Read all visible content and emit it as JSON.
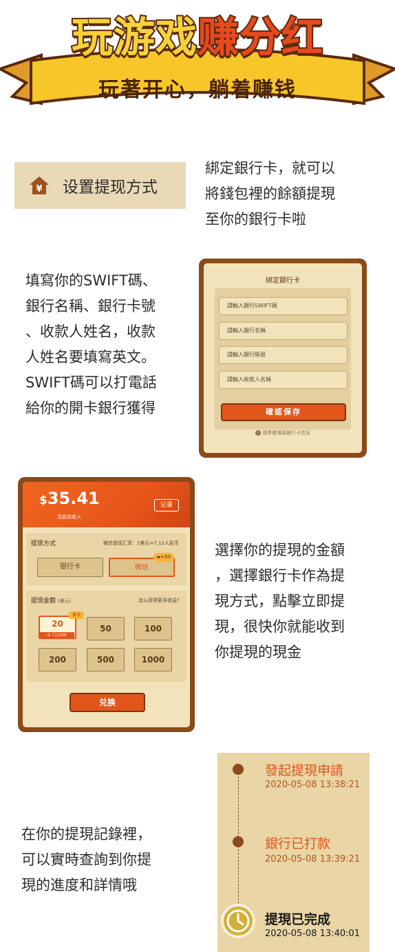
{
  "header": {
    "title_part1": "玩游戏",
    "title_part2": "赚分红",
    "subtitle": "玩著开心，躺着赚钱"
  },
  "section1": {
    "setup_button_label": "设置提现方式",
    "yen_icon": "yen-house-icon",
    "description": [
      "綁定銀行卡，就可以",
      "將錢包裡的餘額提現",
      "至你的銀行卡啦"
    ]
  },
  "section2": {
    "description": [
      "填寫你的SWIFT碼、",
      "銀行名稱、銀行卡號",
      "、收款人姓名，收款",
      "人姓名要填寫英文。",
      "SWIFT碼可以打電話",
      "給你的開卡銀行獲得"
    ],
    "bind_card": {
      "title": "綁定銀行卡",
      "fields": [
        "請輸入銀行SWIFT碼",
        "請輸入銀行名稱",
        "請輸入銀行賬號",
        "請輸入收款人名稱"
      ],
      "save_label": "確認保存",
      "hint": "請準確填寫銀行卡信息"
    }
  },
  "section3": {
    "description": [
      "選擇你的提現的金額",
      "，選擇銀行卡作為提",
      "現方式，點擊立即提",
      "現，很快你就能收到",
      "你提現的現金"
    ],
    "withdraw": {
      "currency": "$",
      "amount": "35.41",
      "amount_label": "当前总收入",
      "record_label": "记录",
      "method_label": "提现方式",
      "rate_text": "微信提现汇率：1美元=7.12人民币",
      "methods": [
        "银行卡",
        "微信"
      ],
      "method_selected": "微信",
      "wechat_bonus": "+50",
      "amount_section_label": "提现金额",
      "amount_unit": "(美元)",
      "help_link": "怎么获得更多收益?",
      "options": [
        "20",
        "50",
        "100",
        "200",
        "500",
        "1000"
      ],
      "first_badge": "首次",
      "first_progress": "11/100",
      "exchange_label": "兑换"
    }
  },
  "section4": {
    "description": [
      "在你的提現記錄裡，",
      "可以實時查詢到你提",
      "現的進度和詳情哦"
    ],
    "timeline": [
      {
        "title": "發起提現申請",
        "time": "2020-05-08 13:38:21"
      },
      {
        "title": "銀行已打款",
        "time": "2020-05-08 13:39:21"
      },
      {
        "title": "提現已完成",
        "time": "2020-05-08 13:40:01"
      }
    ],
    "colors": {
      "accent": "#e2561b",
      "brown": "#8b4a1b",
      "panel": "#e9d5a5"
    }
  }
}
